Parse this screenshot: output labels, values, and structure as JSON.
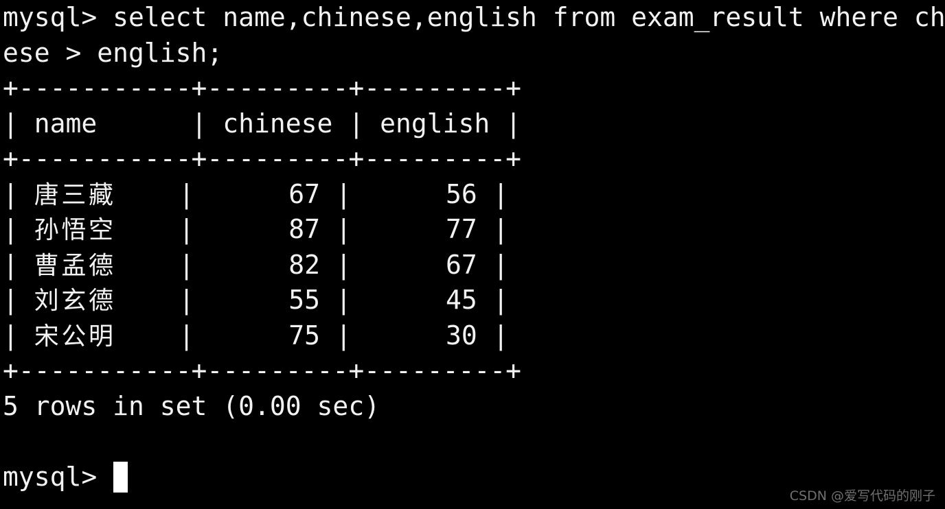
{
  "terminal": {
    "theme": {
      "background": "#000000",
      "foreground": "#f2f2f2",
      "cursor": "#ffffff",
      "watermark_color": "#6f6f6f"
    },
    "prompt": "mysql> ",
    "command": "select name,chinese,english from exam_result where chinese > english;",
    "command_line_1": "mysql> select name,chinese,english from exam_result where chin",
    "command_line_2": "ese > english;",
    "border": "+-----------+---------+---------+",
    "header_row": "| name      | chinese | english |",
    "rows": [
      {
        "line_prefix": "| ",
        "name": "唐三藏",
        "name_pad": "    | ",
        "chinese": "     67",
        "mid": " | ",
        "english": "     56",
        "suffix": " |"
      },
      {
        "line_prefix": "| ",
        "name": "孙悟空",
        "name_pad": "    | ",
        "chinese": "     87",
        "mid": " | ",
        "english": "     77",
        "suffix": " |"
      },
      {
        "line_prefix": "| ",
        "name": "曹孟德",
        "name_pad": "    | ",
        "chinese": "     82",
        "mid": " | ",
        "english": "     67",
        "suffix": " |"
      },
      {
        "line_prefix": "| ",
        "name": "刘玄德",
        "name_pad": "    | ",
        "chinese": "     55",
        "mid": " | ",
        "english": "     45",
        "suffix": " |"
      },
      {
        "line_prefix": "| ",
        "name": "宋公明",
        "name_pad": "    | ",
        "chinese": "     75",
        "mid": " | ",
        "english": "     30",
        "suffix": " |"
      }
    ],
    "result_status": "5 rows in set (0.00 sec)",
    "blank_line": " ",
    "final_prompt": "mysql> ",
    "cursor": "block"
  },
  "table_data": {
    "type": "table",
    "columns": [
      "name",
      "chinese",
      "english"
    ],
    "values": [
      [
        "唐三藏",
        67,
        56
      ],
      [
        "孙悟空",
        87,
        77
      ],
      [
        "曹孟德",
        82,
        67
      ],
      [
        "刘玄德",
        55,
        45
      ],
      [
        "宋公明",
        75,
        30
      ]
    ],
    "row_count": 5,
    "elapsed": "0.00 sec"
  },
  "watermark": {
    "text": "CSDN @爱写代码的刚子"
  }
}
